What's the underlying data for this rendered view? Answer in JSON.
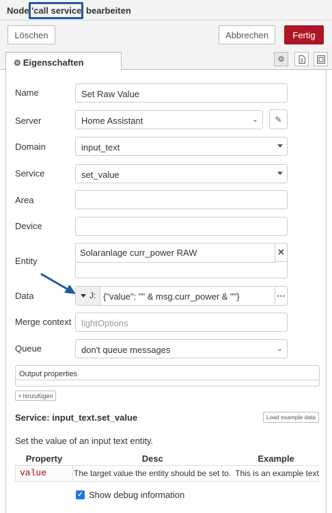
{
  "title": {
    "prefix": "Node ",
    "name": "'call service'",
    "suffix": " bearbeiten"
  },
  "actions": {
    "delete": "Löschen",
    "cancel": "Abbrechen",
    "done": "Fertig"
  },
  "tabs": {
    "properties": "Eigenschaften",
    "icons": [
      "gear-icon",
      "document-icon",
      "frame-icon"
    ]
  },
  "form": {
    "name": {
      "label": "Name",
      "value": "Set Raw Value"
    },
    "server": {
      "label": "Server",
      "value": "Home Assistant"
    },
    "domain": {
      "label": "Domain",
      "value": "input_text"
    },
    "service": {
      "label": "Service",
      "value": "set_value"
    },
    "area": {
      "label": "Area",
      "value": ""
    },
    "device": {
      "label": "Device",
      "value": ""
    },
    "entity": {
      "label": "Entity",
      "value": "Solaranlage curr_power RAW"
    },
    "data": {
      "label": "Data",
      "type": "J:",
      "value": "{\"value\": \"\" & msg.curr_power & \"\"}"
    },
    "merge_context": {
      "label": "Merge context",
      "placeholder": "lightOptions"
    },
    "queue": {
      "label": "Queue",
      "value": "don't queue messages"
    }
  },
  "output_properties": {
    "label": "Output properties",
    "add_label": "hinzufügen"
  },
  "service_info": {
    "title": "Service: input_text.set_value",
    "load_example": "Load example data",
    "description": "Set the value of an input text entity.",
    "table": {
      "headers": [
        "Property",
        "Desc",
        "Example"
      ],
      "rows": [
        {
          "property": "value",
          "desc": "The target value the entity should be set to.",
          "example": "This is an example text"
        }
      ]
    }
  },
  "debug": {
    "label": "Show debug information",
    "checked": true
  },
  "colors": {
    "accent": "#ad1625",
    "highlight_box": "#1f5a9e",
    "arrow": "#1f5a9e",
    "checkbox": "#1e73e8"
  }
}
